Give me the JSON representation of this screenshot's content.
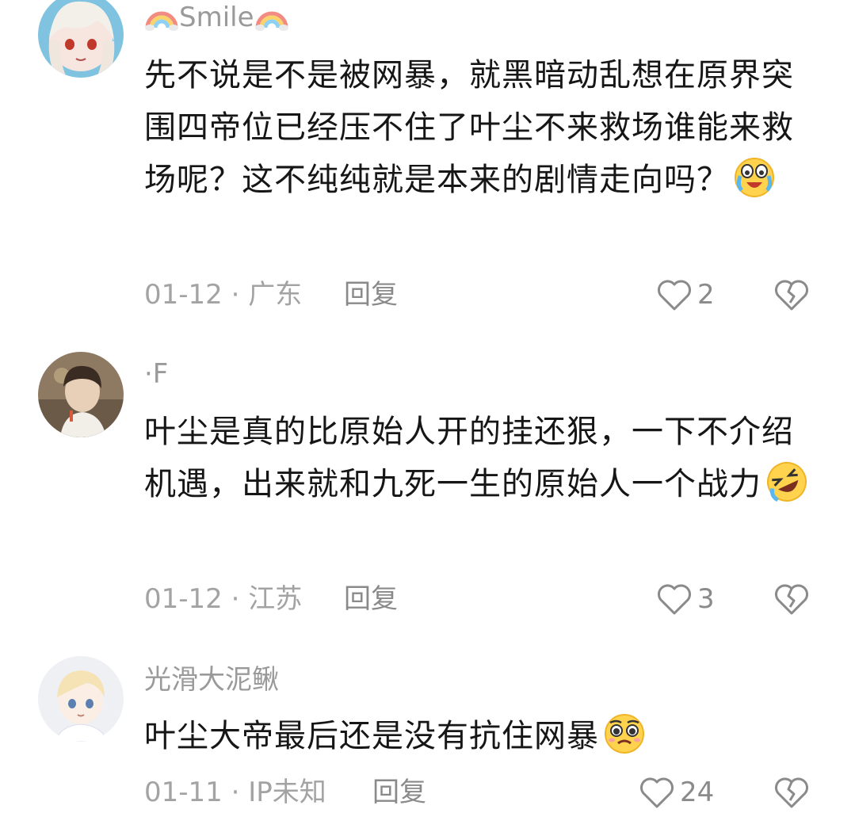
{
  "comments": [
    {
      "username": "Smile",
      "username_decoration_icon": "rainbow-icon",
      "text": "先不说是不是被网暴，就黑暗动乱想在原界突围四帝位已经压不住了叶尘不来救场谁能来救场呢？这不纯纯就是本来的剧情走向吗？",
      "emoji": "crying-tears-emoji",
      "date": "01-12",
      "location": "广东",
      "reply_label": "回复",
      "like_count": "2"
    },
    {
      "username": "·F",
      "text": "叶尘是真的比原始人开的挂还狠，一下不介绍机遇，出来就和九死一生的原始人一个战力",
      "emoji": "rolling-laughing-emoji",
      "date": "01-12",
      "location": "江苏",
      "reply_label": "回复",
      "like_count": "3"
    },
    {
      "username": "光滑大泥鳅",
      "text": "叶尘大帝最后还是没有抗住网暴",
      "emoji": "pleading-face-emoji",
      "date": "01-11",
      "location": "IP未知",
      "reply_label": "回复",
      "like_count": "24"
    }
  ],
  "meta_separator": " · ",
  "colors": {
    "text": "#161616",
    "secondary": "#9a9a9a",
    "icon": "#8a8a8a"
  }
}
